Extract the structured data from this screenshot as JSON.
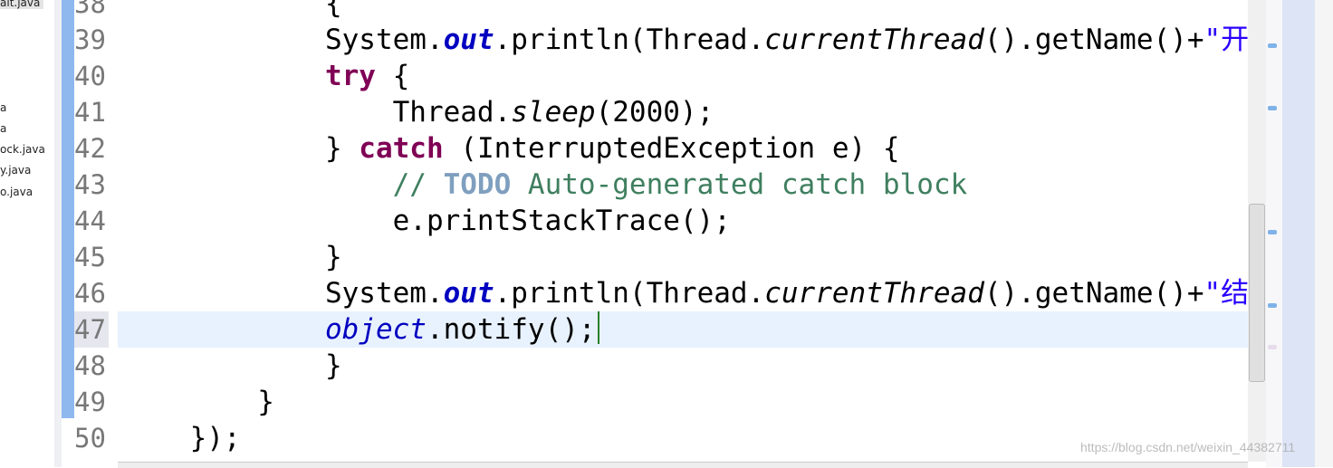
{
  "explorer": {
    "files": [
      "ait.java",
      "a",
      "a",
      "ock.java",
      "y.java",
      "o.java"
    ]
  },
  "lines": [
    {
      "n": "38",
      "tokens": [
        [
          "",
          "            {"
        ]
      ]
    },
    {
      "n": "39",
      "tokens": [
        [
          "",
          "            System."
        ],
        [
          "fld",
          "out"
        ],
        [
          "",
          ".println(Thread."
        ],
        [
          "it",
          "currentThread"
        ],
        [
          "",
          "().getName()+"
        ],
        [
          "str",
          "\"开"
        ]
      ]
    },
    {
      "n": "40",
      "tokens": [
        [
          "",
          "            "
        ],
        [
          "kw",
          "try"
        ],
        [
          "",
          " {"
        ]
      ]
    },
    {
      "n": "41",
      "tokens": [
        [
          "",
          "                Thread."
        ],
        [
          "it",
          "sleep"
        ],
        [
          "",
          "(2000);"
        ]
      ]
    },
    {
      "n": "42",
      "tokens": [
        [
          "",
          "            } "
        ],
        [
          "kw",
          "catch"
        ],
        [
          "",
          " (InterruptedException e) {"
        ]
      ]
    },
    {
      "n": "43",
      "tokens": [
        [
          "cm",
          "                // "
        ],
        [
          "todo",
          "TODO"
        ],
        [
          "cm",
          " Auto-generated catch block"
        ]
      ]
    },
    {
      "n": "44",
      "tokens": [
        [
          "",
          "                e.printStackTrace();"
        ]
      ]
    },
    {
      "n": "45",
      "tokens": [
        [
          "",
          "            }"
        ]
      ]
    },
    {
      "n": "46",
      "tokens": [
        [
          "",
          "            System."
        ],
        [
          "fld",
          "out"
        ],
        [
          "",
          ".println(Thread."
        ],
        [
          "it",
          "currentThread"
        ],
        [
          "",
          "().getName()+"
        ],
        [
          "str",
          "\"结"
        ]
      ]
    },
    {
      "n": "47",
      "tokens": [
        [
          "",
          "            "
        ],
        [
          "fit",
          "object"
        ],
        [
          "",
          ".notify();"
        ]
      ],
      "current": true
    },
    {
      "n": "48",
      "tokens": [
        [
          "",
          "            }"
        ]
      ]
    },
    {
      "n": "49",
      "tokens": [
        [
          "",
          "        }"
        ]
      ]
    },
    {
      "n": "50",
      "tokens": [
        [
          "",
          "    });"
        ]
      ]
    }
  ],
  "watermark": "https://blog.csdn.net/weixin_44382711"
}
